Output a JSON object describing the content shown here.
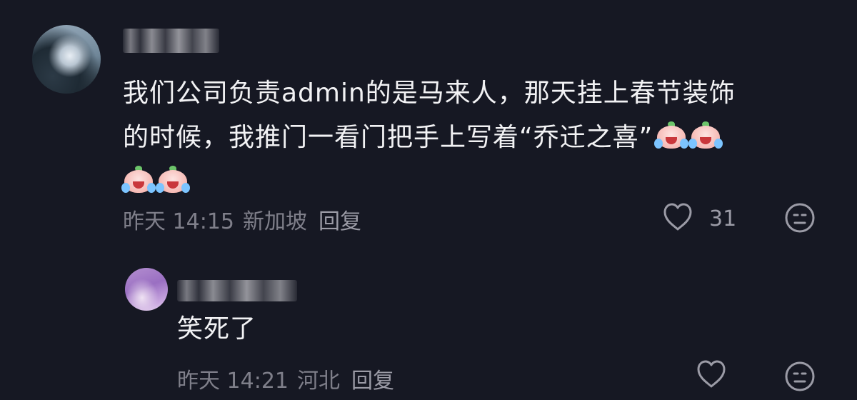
{
  "comments": [
    {
      "text_line1": "我们公司负责admin的是马来人，那天挂上春节装饰",
      "text_line2": "的时候，我推门一看门把手上写着“乔迁之喜”",
      "time": "昨天 14:15",
      "location": "新加坡",
      "reply_label": "回复",
      "like_count": "31",
      "emoji_name": "crying-laughing-peach",
      "emoji_count": 4
    },
    {
      "text": "笑死了",
      "time": "昨天 14:21",
      "location": "河北",
      "reply_label": "回复"
    }
  ],
  "colors": {
    "background": "#161823",
    "primary_text": "#f2f2f4",
    "secondary_text": "#7f7f8a"
  },
  "icons": {
    "like": "heart-outline-icon",
    "dislike": "meh-face-icon"
  }
}
